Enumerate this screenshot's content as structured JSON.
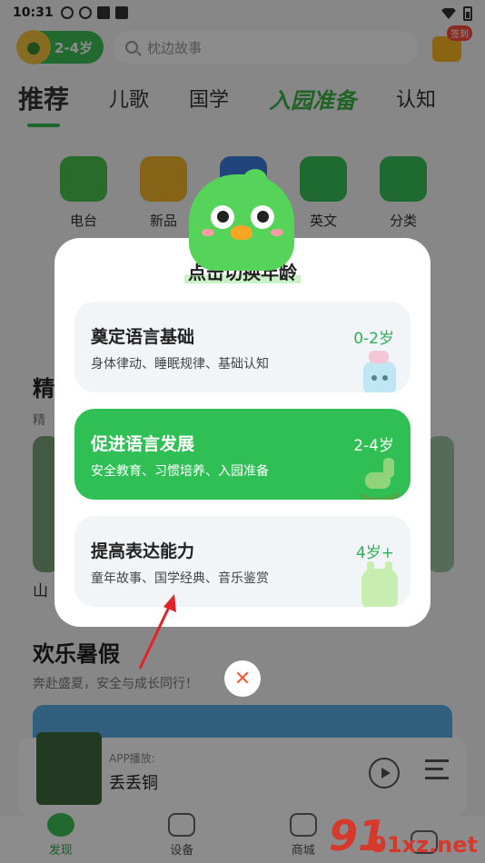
{
  "status_bar": {
    "time": "10:31"
  },
  "header": {
    "age_label": "2-4岁",
    "search_placeholder": "枕边故事",
    "gift_badge": "签到"
  },
  "tabs": [
    {
      "label": "推荐",
      "active": true
    },
    {
      "label": "儿歌"
    },
    {
      "label": "国学"
    },
    {
      "label": "入园准备",
      "special": true
    },
    {
      "label": "认知"
    }
  ],
  "categories": [
    {
      "label": "电台",
      "icon": "radio-icon",
      "color": "#4cc34f"
    },
    {
      "label": "新品",
      "icon": "new-icon",
      "color": "#f5b62a"
    },
    {
      "label": "",
      "icon": "book-icon",
      "color": "#3d7de0"
    },
    {
      "label": "英文",
      "icon": "english-icon",
      "color": "#39c25a"
    },
    {
      "label": "分类",
      "icon": "category-icon",
      "color": "#39c25a"
    }
  ],
  "background": {
    "section1_title": "精",
    "section1_sub": "精",
    "card_label": "山",
    "section2_title": "欢乐暑假",
    "section2_sub": "奔赴盛夏，安全与成长同行！"
  },
  "player": {
    "source": "APP播放:",
    "song": "丢丢铜"
  },
  "bottom_nav": [
    {
      "label": "发现",
      "icon": "discover-icon",
      "active": true
    },
    {
      "label": "设备",
      "icon": "device-icon"
    },
    {
      "label": "商城",
      "icon": "shop-icon"
    },
    {
      "label": "",
      "icon": "profile-icon"
    }
  ],
  "modal": {
    "title": "点击切换年龄",
    "options": [
      {
        "title": "奠定语言基础",
        "desc": "身体律动、睡眠规律、基础认知",
        "age": "0-2岁",
        "selected": false
      },
      {
        "title": "促进语言发展",
        "desc": "安全教育、习惯培养、入园准备",
        "age": "2-4岁",
        "selected": true
      },
      {
        "title": "提高表达能力",
        "desc": "童年故事、国学经典、音乐鉴赏",
        "age": "4岁+",
        "selected": false
      }
    ],
    "close_symbol": "✕"
  },
  "watermark": "91xz.net",
  "colors": {
    "accent": "#2fbf55",
    "close": "#f25c3c",
    "arrow": "#e0242a"
  }
}
